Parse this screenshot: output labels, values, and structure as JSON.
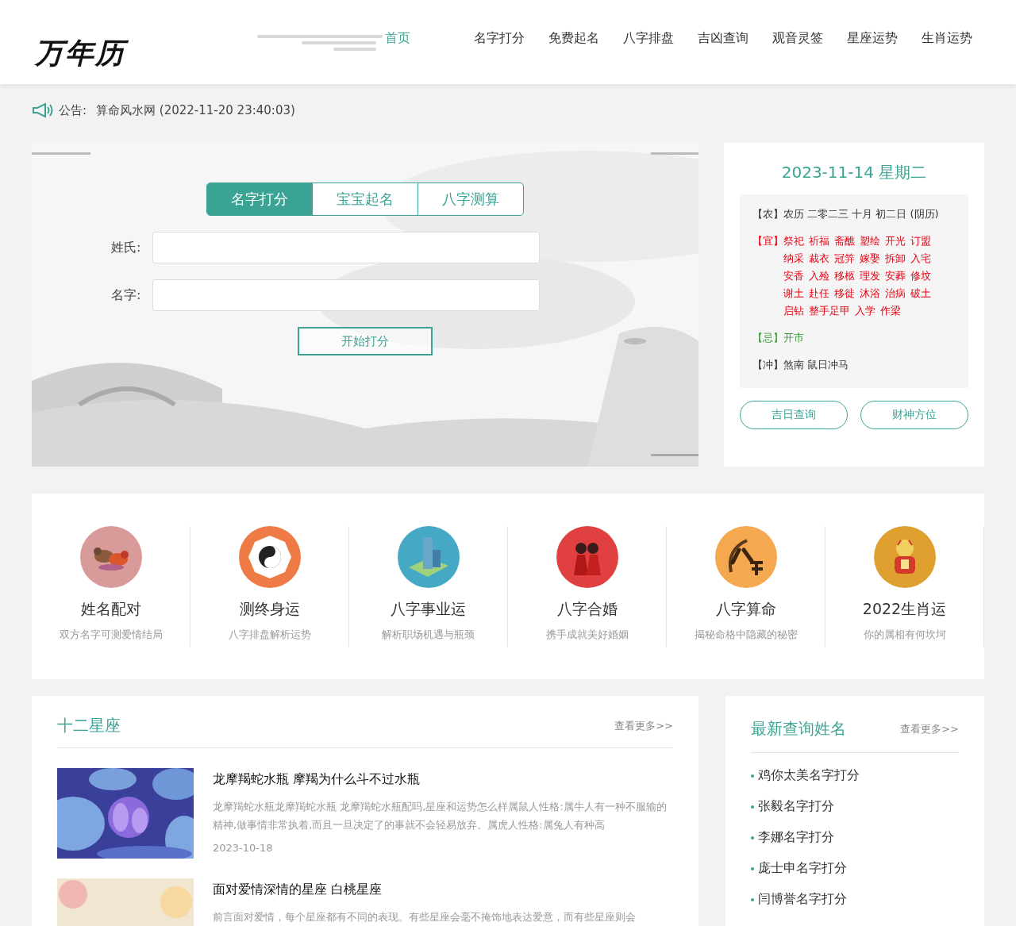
{
  "header": {
    "logo": "万年历",
    "nav": [
      {
        "label": "首页",
        "selected": true
      },
      {
        "label": "名字打分",
        "selected": false
      },
      {
        "label": "免费起名",
        "selected": false
      },
      {
        "label": "八字排盘",
        "selected": false
      },
      {
        "label": "吉凶查询",
        "selected": false
      },
      {
        "label": "观音灵签",
        "selected": false
      },
      {
        "label": "星座运势",
        "selected": false
      },
      {
        "label": "生肖运势",
        "selected": false
      }
    ]
  },
  "notice": {
    "label": "公告:",
    "text": "算命风水网 (2022-11-20 23:40:03)"
  },
  "search": {
    "tabs": [
      {
        "label": "名字打分",
        "selected": true
      },
      {
        "label": "宝宝起名",
        "selected": false
      },
      {
        "label": "八字测算",
        "selected": false
      }
    ],
    "fields": [
      {
        "label": "姓氏:"
      },
      {
        "label": "名字:"
      }
    ],
    "button": "开始打分"
  },
  "calendar": {
    "date": "2023-11-14 星期二",
    "rows": [
      {
        "kind": "lunar",
        "tag": "【农】",
        "text": "农历 二零二三 十月 初二日 (阴历)"
      },
      {
        "kind": "good",
        "tag": "【宜】",
        "words": [
          "祭祀",
          "祈福",
          "斋醮",
          "塑绘",
          "开光",
          "订盟",
          "纳采",
          "裁衣",
          "冠笄",
          "嫁娶",
          "拆卸",
          "入宅",
          "安香",
          "入殓",
          "移柩",
          "理发",
          "安葬",
          "修坟",
          "谢土",
          "赴任",
          "移徙",
          "沐浴",
          "治病",
          "破土",
          "启钻",
          "整手足甲",
          "入学",
          "作梁"
        ]
      },
      {
        "kind": "bad",
        "tag": "【忌】",
        "text": "开市"
      },
      {
        "kind": "clash",
        "tag": "【冲】",
        "text": "煞南 鼠日冲马"
      }
    ],
    "buttons": [
      "吉日查询",
      "财神方位"
    ]
  },
  "features": [
    {
      "title": "姓名配对",
      "subtitle": "双方名字可测爱情结局"
    },
    {
      "title": "测终身运",
      "subtitle": "八字排盘解析运势"
    },
    {
      "title": "八字事业运",
      "subtitle": "解析职场机遇与瓶颈"
    },
    {
      "title": "八字合婚",
      "subtitle": "携手成就美好婚姻"
    },
    {
      "title": "八字算命",
      "subtitle": "揭秘命格中隐藏的秘密"
    },
    {
      "title": "2022生肖运",
      "subtitle": "你的属相有何坎坷"
    }
  ],
  "zodiac": {
    "title": "十二星座",
    "more": "查看更多>>",
    "articles": [
      {
        "title": "龙摩羯蛇水瓶 摩羯为什么斗不过水瓶",
        "summary": "龙摩羯蛇水瓶龙摩羯蛇水瓶 龙摩羯蛇水瓶配吗,星座和运势怎么样属鼠人性格:属牛人有一种不服输的精神,做事情非常执着,而且一旦决定了的事就不会轻易放弃。属虎人性格:属兔人有种高",
        "date": "2023-10-18"
      },
      {
        "title": "面对爱情深情的星座 白桃星座",
        "summary": "前言面对爱情，每个星座都有不同的表现。有些星座会毫不掩饰地表达爱意，而有些星座则会"
      }
    ]
  },
  "latest": {
    "title": "最新查询姓名",
    "more": "查看更多>>",
    "items": [
      "鸡你太美名字打分",
      "张毅名字打分",
      "李娜名字打分",
      "庞士申名字打分",
      "闫博誉名字打分"
    ]
  }
}
